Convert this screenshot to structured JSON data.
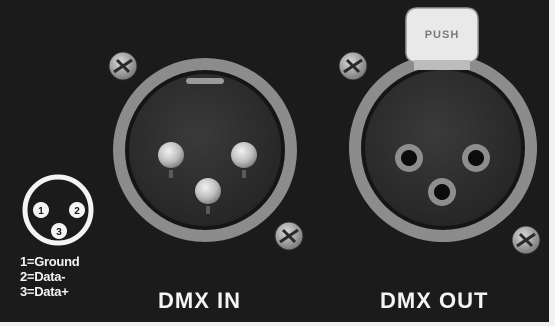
{
  "labels": {
    "dmx_in": "DMX IN",
    "dmx_out": "DMX OUT"
  },
  "pinout_legend": [
    "1=Ground",
    "2=Data-",
    "3=Data+"
  ],
  "pin_numbers": [
    "1",
    "2",
    "3"
  ],
  "latch_text": "PUSH",
  "colors": {
    "panel": "#1b1b1b",
    "ring": "#8c8c8c",
    "connector_face": "#2e2e2e",
    "text": "#f4f4f4"
  }
}
